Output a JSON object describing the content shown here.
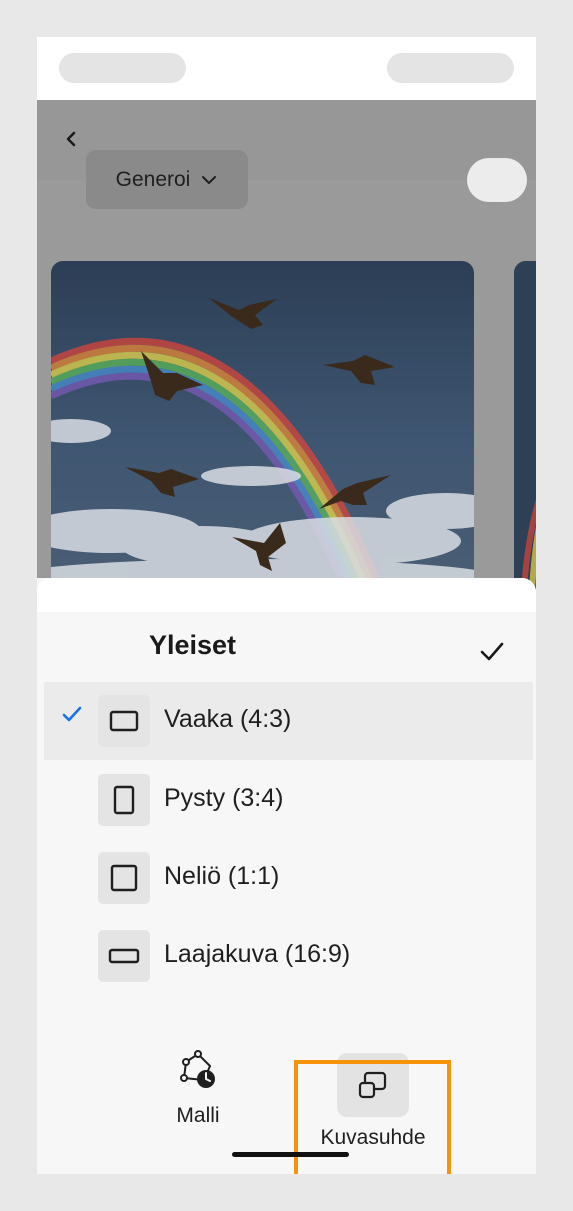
{
  "header": {
    "generate_label": "Generoi"
  },
  "sheet": {
    "section_title": "Yleiset",
    "options": [
      {
        "label": "Vaaka (4:3)",
        "selected": true
      },
      {
        "label": "Pysty (3:4)",
        "selected": false
      },
      {
        "label": "Neliö (1:1)",
        "selected": false
      },
      {
        "label": "Laajakuva (16:9)",
        "selected": false
      }
    ]
  },
  "bottom_tabs": [
    {
      "label": "Malli",
      "icon": "model-clock-icon"
    },
    {
      "label": "Kuvasuhde",
      "icon": "aspect-ratio-icon",
      "highlighted": true
    }
  ],
  "colors": {
    "accent_check": "#1473e6",
    "highlight": "#f7920b"
  }
}
